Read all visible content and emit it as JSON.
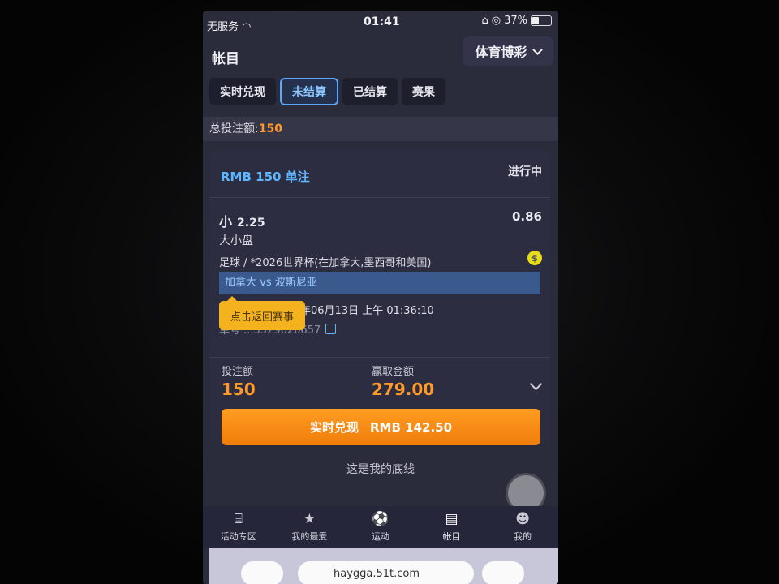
{
  "status_bar": {
    "carrier": "无服务",
    "time": "01:41",
    "battery": "37%",
    "battery_fill": 0.37
  },
  "header": {
    "title": "帐目",
    "sport_selector": "体育博彩"
  },
  "tabs": [
    {
      "label": "实时兑现",
      "active": false
    },
    {
      "label": "未结算",
      "active": true
    },
    {
      "label": "已结算",
      "active": false
    },
    {
      "label": "赛果",
      "active": false
    }
  ],
  "summary": {
    "total_label": "总投注额:",
    "total_value": "150"
  },
  "bet": {
    "title": "RMB 150 单注",
    "status": "进行中",
    "pick": "小",
    "line": "2.25",
    "odds": "0.86",
    "market": "大小盘",
    "league": "足球 / *2026世界杯(在加拿大,墨西哥和美国)",
    "match": "加拿大 vs 波斯尼亚",
    "time_text": "年06月13日 上午 01:36:10",
    "ticket_text": "单号 ...3529626657",
    "tooltip": "点击返回赛事",
    "stake_label": "投注额",
    "stake_value": "150",
    "win_label": "赢取金额",
    "win_value": "279.00",
    "cashout_label": "实时兑现",
    "cashout_amount": "RMB 142.50"
  },
  "footer_note": "这是我的底线",
  "bottom_nav": [
    {
      "label": "活动专区",
      "icon": "gift-icon",
      "glyph": "⌸"
    },
    {
      "label": "我的最爱",
      "icon": "star-icon",
      "glyph": "★"
    },
    {
      "label": "运动",
      "icon": "soccer-ball-icon",
      "glyph": "⚽"
    },
    {
      "label": "帐目",
      "icon": "receipt-icon",
      "glyph": "▤"
    },
    {
      "label": "我的",
      "icon": "user-icon",
      "glyph": "☻"
    }
  ],
  "browser": {
    "url": "haygga.51t.com"
  }
}
